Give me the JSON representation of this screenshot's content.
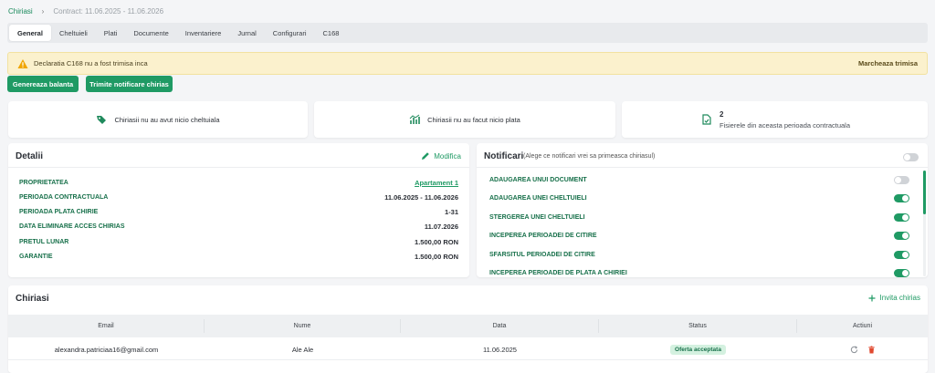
{
  "breadcrumb": {
    "root": "Chiriasi",
    "separator": "›",
    "current": "Contract: 11.06.2025 - 11.06.2026"
  },
  "tabs": [
    "General",
    "Cheltuieli",
    "Plati",
    "Documente",
    "Inventariere",
    "Jurnal",
    "Configurari",
    "C168"
  ],
  "alert": {
    "text": "Declaratia C168 nu a fost trimisa inca",
    "action": "Marcheaza trimisa"
  },
  "buttons": {
    "balanta": "Genereaza balanta",
    "notificare": "Trimite notificare chirias"
  },
  "stats": {
    "expenses": "Chiriasii nu au avut nicio cheltuiala",
    "payments": "Chiriasii nu au facut nicio plata",
    "files_count": "2",
    "files_label": "Fisierele din aceasta perioada contractuala"
  },
  "details": {
    "title": "Detalii",
    "edit": "Modifica",
    "rows": [
      {
        "label": "PROPRIETATEA",
        "value": "Apartament 1"
      },
      {
        "label": "PERIOADA CONTRACTUALA",
        "value": "11.06.2025 - 11.06.2026"
      },
      {
        "label": "PERIOADA PLATA CHIRIE",
        "value": "1-31"
      },
      {
        "label": "DATA ELIMINARE ACCES CHIRIAS",
        "value": "11.07.2026"
      },
      {
        "label": "PRETUL LUNAR",
        "value": "1.500,00 RON"
      },
      {
        "label": "GARANTIE",
        "value": "1.500,00 RON"
      }
    ]
  },
  "notifications": {
    "title": "Notificari",
    "subtitle": "(Alege ce notificari vrei sa primeasca chiriasul)",
    "master_on": false,
    "items": [
      {
        "label": "ADAUGAREA UNUI DOCUMENT",
        "on": false
      },
      {
        "label": "ADAUGAREA UNEI CHELTUIELI",
        "on": true
      },
      {
        "label": "STERGEREA UNEI CHELTUIELI",
        "on": true
      },
      {
        "label": "INCEPEREA PERIOADEI DE CITIRE",
        "on": true
      },
      {
        "label": "SFARSITUL PERIOADEI DE CITIRE",
        "on": true
      },
      {
        "label": "INCEPEREA PERIOADEI DE PLATA A CHIRIEI",
        "on": true
      }
    ]
  },
  "tenants": {
    "title": "Chiriasi",
    "invite": "Invita chirias",
    "columns": [
      "Email",
      "Nume",
      "Data",
      "Status",
      "Actiuni"
    ],
    "rows": [
      {
        "email": "alexandra.patriciaa16@gmail.com",
        "name": "Ale Ale",
        "date": "11.06.2025",
        "status": "Oferta acceptata"
      }
    ]
  },
  "colors": {
    "accent": "#1f9a64",
    "alert_bg": "#fbf1cd",
    "delete": "#e0482f"
  },
  "icons": {
    "alert": "warning-icon",
    "expenses": "tag-icon",
    "payments": "coins-icon",
    "files": "file-icon",
    "edit": "pencil-icon",
    "invite": "plus-icon",
    "resend": "refresh-icon",
    "delete": "trash-icon"
  }
}
